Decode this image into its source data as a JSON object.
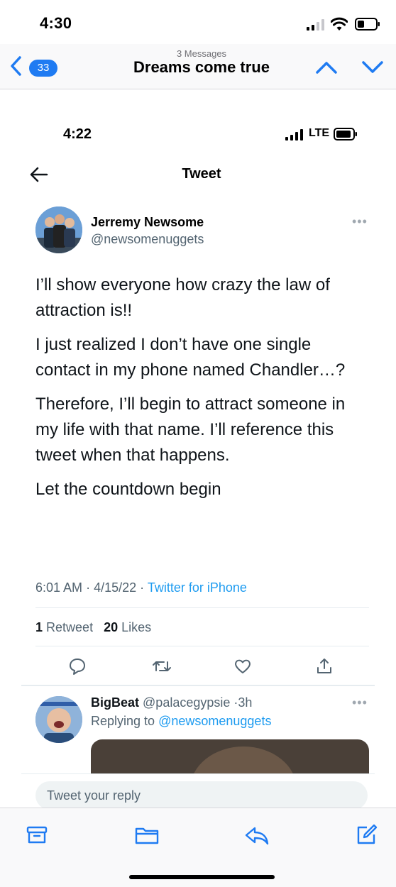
{
  "status_bar": {
    "time": "4:30"
  },
  "mail_nav": {
    "back_count": "33",
    "subtitle": "3 Messages",
    "title": "Dreams come true"
  },
  "embedded": {
    "status": {
      "time": "4:22",
      "network": "LTE"
    },
    "header_title": "Tweet",
    "tweet": {
      "author_name": "Jerremy Newsome",
      "author_handle": "@newsomenuggets",
      "paragraphs": [
        "I’ll show everyone how crazy the law of attraction is!!",
        "I just realized I don’t have one single contact in my phone named Chandler…?",
        "Therefore, I’ll begin to attract someone in my life with that name. I’ll reference this tweet when that happens.",
        "Let the countdown begin"
      ],
      "time": "6:01 AM",
      "date": "4/15/22",
      "source": "Twitter for iPhone",
      "retweets": "1",
      "retweets_label": "Retweet",
      "likes": "20",
      "likes_label": "Likes"
    },
    "reply": {
      "name": "BigBeat",
      "handle": "@palacegypsie",
      "age": "3h",
      "replying_to_label": "Replying to",
      "replying_to": "@newsomenuggets"
    },
    "reply_placeholder": "Tweet your reply"
  },
  "toolbar": {
    "icons": [
      "archive-icon",
      "folder-icon",
      "reply-icon",
      "compose-icon"
    ]
  },
  "colors": {
    "ios_blue": "#1f7bf2",
    "twitter_blue": "#1d9bf0",
    "muted": "#536471"
  }
}
